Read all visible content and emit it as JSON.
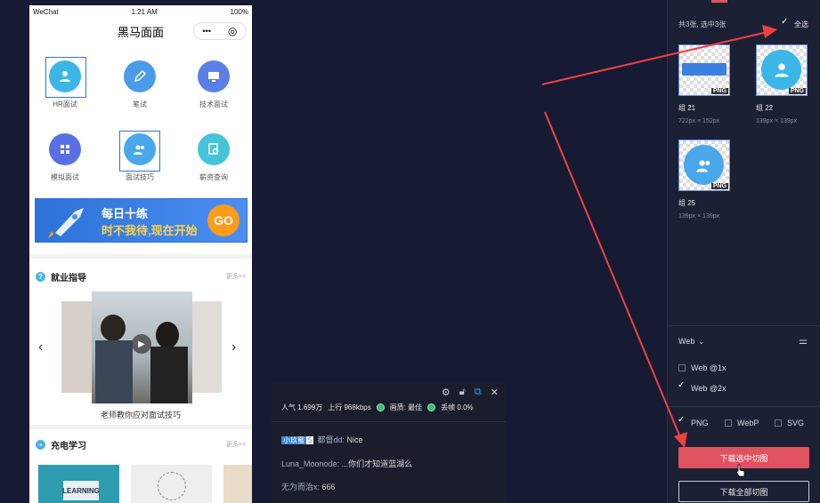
{
  "phone": {
    "status": {
      "carrier": "WeChat",
      "time": "1:21 AM",
      "battery": "100%"
    },
    "title": "黑马面面",
    "capsule": {
      "more": "•••",
      "close": "◎"
    },
    "grid": [
      {
        "label": "HR面试",
        "icon": "user-icon",
        "color": "#3cb6e6"
      },
      {
        "label": "笔试",
        "icon": "pencil-icon",
        "color": "#4a9be8"
      },
      {
        "label": "技术面试",
        "icon": "monitor-icon",
        "color": "#5a7fe6"
      },
      {
        "label": "模拟面试",
        "icon": "grid-icon",
        "color": "#5a6ee6"
      },
      {
        "label": "面试技巧",
        "icon": "users-icon",
        "color": "#4aa7ea"
      },
      {
        "label": "薪资查询",
        "icon": "search-doc-icon",
        "color": "#45c4d9"
      }
    ],
    "banner": {
      "line1": "每日十练",
      "line2": "时不我待,现在开始",
      "go": "GO"
    },
    "section1": {
      "title": "就业指导",
      "more": "更多>>",
      "caption": "老师教你应对面试技巧"
    },
    "section2": {
      "title": "充电学习",
      "more": "更多>>",
      "learning": "LEARNING"
    }
  },
  "live": {
    "stats": {
      "popularity": "人气 1.699万",
      "upload": "上行 968kbps",
      "quality": "画质: 最佳",
      "drop": "丢帧 0.0%"
    },
    "chat": [
      {
        "badge_name": "小玖蜜",
        "badge_level": "5",
        "user": "都督dd",
        "msg": "Nice"
      },
      {
        "user": "Luna_Moonode",
        "msg": "...你们才知道蓝湖么"
      },
      {
        "user": "无为而治x",
        "msg": "666"
      }
    ]
  },
  "panel": {
    "count_text": "共3张, 选中3张",
    "select_all": "全选",
    "items": [
      {
        "name": "组 21",
        "size": "722px × 152px",
        "badge": "PNG"
      },
      {
        "name": "组 22",
        "size": "139px × 139px",
        "badge": "PNG"
      },
      {
        "name": "组 25",
        "size": "139px × 139px",
        "badge": "PNG"
      }
    ],
    "platform": "Web",
    "scales": [
      {
        "label": "Web @1x",
        "checked": false
      },
      {
        "label": "Web @2x",
        "checked": true
      }
    ],
    "formats": [
      {
        "label": "PNG",
        "checked": true
      },
      {
        "label": "WebP",
        "checked": false
      },
      {
        "label": "SVG",
        "checked": false
      }
    ],
    "download_selected": "下载选中切图",
    "download_all": "下载全部切图",
    "accent": "#e0525f"
  }
}
